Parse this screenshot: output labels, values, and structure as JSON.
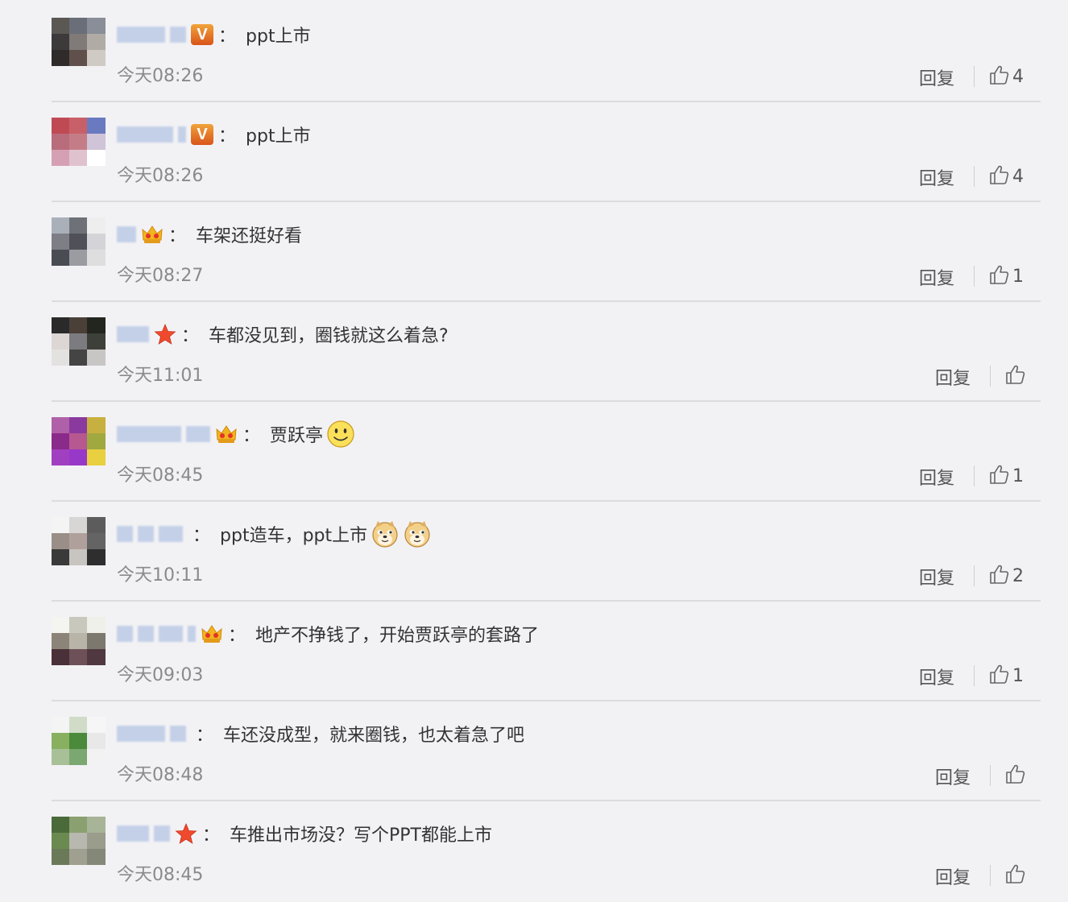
{
  "reply_label": "回复",
  "comments": [
    {
      "badge": "v",
      "text": "ppt上市",
      "time": "今天08:26",
      "likes": "4",
      "avatar": [
        "#5b5753",
        "#6a6e78",
        "#8a8e98",
        "#3c3a3a",
        "#807a78",
        "#b0aba5",
        "#2e2b2a",
        "#60504c",
        "#cfcac4"
      ]
    },
    {
      "badge": "v",
      "text": "ppt上市",
      "time": "今天08:26",
      "likes": "4",
      "avatar": [
        "#c04a54",
        "#c8606a",
        "#6a7ac0",
        "#b86c7c",
        "#c47d86",
        "#cfc4d8",
        "#d6a0b4",
        "#e0c2cf",
        "#ffffff"
      ]
    },
    {
      "badge": "crown",
      "text": "车架还挺好看",
      "time": "今天08:27",
      "likes": "1",
      "avatar": [
        "#aab0ba",
        "#6e7178",
        "#eeeeee",
        "#7e7e86",
        "#505158",
        "#d4d4d8",
        "#4a4c54",
        "#9a9ca2",
        "#dededf"
      ]
    },
    {
      "badge": "star",
      "text": "车都没见到，圈钱就这么着急?",
      "time": "今天11:01",
      "likes": "",
      "avatar": [
        "#2a2a2a",
        "#4a4038",
        "#22261e",
        "#dcd6d4",
        "#7c7c80",
        "#3c4038",
        "#e4e2e0",
        "#444",
        "#c8c6c4"
      ]
    },
    {
      "badge": "crown",
      "text": "贾跃亭",
      "time": "今天08:45",
      "likes": "1",
      "emojis": [
        "smile"
      ],
      "avatar": [
        "#b060a8",
        "#8a3a9e",
        "#c8b040",
        "#8a2a8a",
        "#b85890",
        "#a0a840",
        "#a040c0",
        "#9838c8",
        "#e8d040"
      ]
    },
    {
      "badge": "none",
      "text": "ppt造车，ppt上市",
      "time": "今天10:11",
      "likes": "2",
      "emojis": [
        "doge",
        "doge"
      ],
      "avatar": [
        "#f4f4f4",
        "#d8d6d4",
        "#5c5c5c",
        "#9a8e88",
        "#b0a09c",
        "#646464",
        "#3a3a3a",
        "#c8c4c0",
        "#2e2e2e"
      ]
    },
    {
      "badge": "crown",
      "text": "地产不挣钱了，开始贾跃亭的套路了",
      "time": "今天09:03",
      "likes": "1",
      "avatar": [
        "#f4f4f0",
        "#c8c8bc",
        "#f0f0ea",
        "#8c8478",
        "#b8b4a8",
        "#7c786e",
        "#4a3038",
        "#6e5058",
        "#503840"
      ]
    },
    {
      "badge": "none",
      "text": "车还没成型，就来圈钱，也太着急了吧",
      "time": "今天08:48",
      "likes": "",
      "avatar": [
        "#f4f4f4",
        "#d0dcc8",
        "#f6f6f6",
        "#88b060",
        "#4a8a3a",
        "#e8e8e8",
        "#a8c098",
        "#7aa870",
        "#f2f2f2"
      ]
    },
    {
      "badge": "star",
      "text": "车推出市场没？写个PPT都能上市",
      "time": "今天08:45",
      "likes": "",
      "avatar": [
        "#4a6a3a",
        "#8aa070",
        "#a8b498",
        "#6a8a50",
        "#b8b8b0",
        "#9a9c8c",
        "#6a7a58",
        "#a0a090",
        "#848878"
      ]
    }
  ]
}
